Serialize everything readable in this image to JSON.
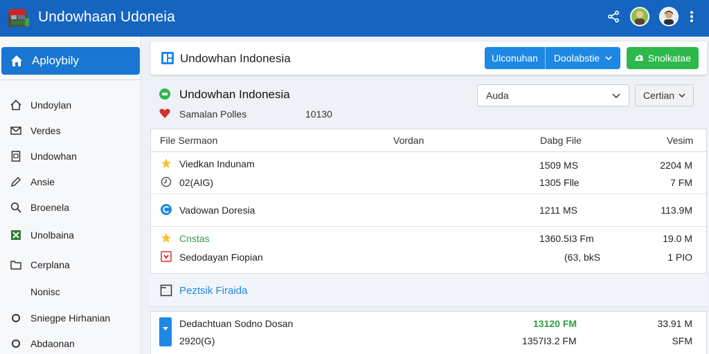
{
  "app": {
    "title": "Undowhaan Udoneia"
  },
  "sidebar": {
    "active": "Aploybily",
    "items": [
      {
        "label": "Undoylan",
        "icon": "home-outline-icon"
      },
      {
        "label": "Verdes",
        "icon": "envelope-icon"
      },
      {
        "label": "Undowhan",
        "icon": "file-icon"
      },
      {
        "label": "Ansie",
        "icon": "pencil-icon"
      },
      {
        "label": "Broenela",
        "icon": "search-icon"
      },
      {
        "label": "Unolbaina",
        "icon": "spreadsheet-icon"
      },
      {
        "label": "Cerplana",
        "icon": "folder-icon"
      },
      {
        "label": "Nonisc",
        "icon": ""
      },
      {
        "label": "Sniegpe Hirhanian",
        "icon": "circle-icon"
      },
      {
        "label": "Abdaonan",
        "icon": "circle-icon"
      }
    ]
  },
  "header": {
    "title": "Undowhan Indonesia",
    "split_left": "Ulconuhan",
    "split_right": "Doolabstie",
    "green_button": "Snolkatae"
  },
  "group": {
    "title": "Undowhan Indonesia",
    "sub_label": "Samalan Polles",
    "sub_value": "10130",
    "select_value": "Auda",
    "certian_label": "Certian"
  },
  "table": {
    "headers": [
      "File Sermaon",
      "Vordan",
      "Dabg File",
      "Vesim"
    ],
    "rows": [
      {
        "name": "Viedkan Indunam",
        "size": "1509 MS",
        "ver": "2204 M",
        "icon": "star-icon"
      },
      {
        "name": "02(AIG)",
        "size": "1305 Flle",
        "ver": "7 FM",
        "icon": "clock-icon"
      },
      {
        "name": "Vadowan Doresia",
        "size": "1211 MS",
        "ver": "113.9M",
        "icon": "refresh-icon"
      },
      {
        "name": "Cnstas",
        "size": "1360.5I3 Fm",
        "ver": "19.0 M",
        "icon": "star-icon",
        "highlight": true
      },
      {
        "name": "Sedodayan Fiopian",
        "size": "(63, bkS",
        "ver": "1 PIO",
        "icon": "pdf-icon"
      }
    ]
  },
  "section": {
    "title": "Peztsik Firaida"
  },
  "table2": {
    "rows": [
      {
        "name": "Dedachtuan Sodno Dosan",
        "size": "13120 FM",
        "ver": "33.91 M",
        "highlight_size": true
      },
      {
        "name": "2920(G)",
        "size": "1357I3.2 FM",
        "ver": "SFM"
      }
    ]
  },
  "colors": {
    "primary": "#1565c0",
    "accent": "#1e88e5",
    "green": "#2db84b"
  }
}
